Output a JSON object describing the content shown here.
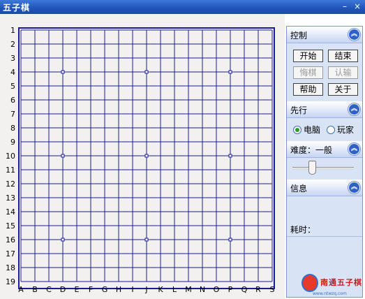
{
  "window": {
    "title": "五子棋",
    "minimize_glyph": "–",
    "close_glyph": "×"
  },
  "board": {
    "row_labels": [
      "1",
      "2",
      "3",
      "4",
      "5",
      "6",
      "7",
      "8",
      "9",
      "10",
      "11",
      "12",
      "13",
      "14",
      "15",
      "16",
      "17",
      "18",
      "19"
    ],
    "col_labels": [
      "A",
      "B",
      "C",
      "D",
      "E",
      "F",
      "G",
      "H",
      "I",
      "J",
      "K",
      "L",
      "M",
      "N",
      "O",
      "P",
      "Q",
      "R",
      "S"
    ],
    "star_points": [
      "D4",
      "J4",
      "P4",
      "D10",
      "J10",
      "P10",
      "D16",
      "J16",
      "P16"
    ],
    "line_color": "#1a1a9a"
  },
  "panel": {
    "control": {
      "title": "控制",
      "icon": "double-chevron-up-icon"
    },
    "buttons": [
      {
        "label": "开始",
        "enabled": true
      },
      {
        "label": "结束",
        "enabled": true
      },
      {
        "label": "悔棋",
        "enabled": false
      },
      {
        "label": "认输",
        "enabled": false
      },
      {
        "label": "帮助",
        "enabled": true
      },
      {
        "label": "关于",
        "enabled": true
      }
    ],
    "first_move": {
      "title": "先行",
      "options": [
        {
          "label": "电脑",
          "selected": true
        },
        {
          "label": "玩家",
          "selected": false
        }
      ]
    },
    "difficulty": {
      "title": "难度：一般",
      "slider_value": 0.3
    },
    "info": {
      "title": "信息",
      "time_label": "耗时："
    }
  },
  "logo": {
    "text": "南通五子棋",
    "url": "www.ntwzq.com"
  }
}
